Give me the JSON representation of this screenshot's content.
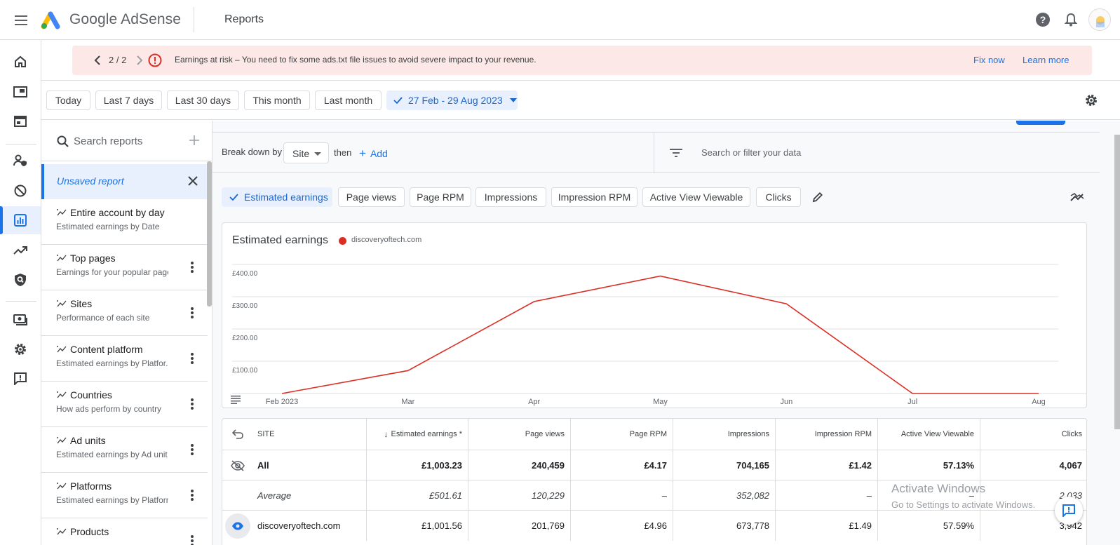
{
  "app": {
    "brand": "Google AdSense",
    "page_title": "Reports"
  },
  "alert": {
    "pager": "2 / 2",
    "message": "Earnings at risk – You need to fix some ads.txt file issues to avoid severe impact to your revenue.",
    "fix_now": "Fix now",
    "learn_more": "Learn more"
  },
  "date_ranges": [
    "Today",
    "Last 7 days",
    "Last 30 days",
    "This month",
    "Last month"
  ],
  "date_selected": "27 Feb - 29 Aug 2023",
  "sidebar": {
    "search_placeholder": "Search reports",
    "unsaved": "Unsaved report",
    "reports": [
      {
        "title": "Entire account by day",
        "subtitle": "Estimated earnings by Date"
      },
      {
        "title": "Top pages",
        "subtitle": "Earnings for your popular pages"
      },
      {
        "title": "Sites",
        "subtitle": "Performance of each site"
      },
      {
        "title": "Content platform",
        "subtitle": "Estimated earnings by Platfor..."
      },
      {
        "title": "Countries",
        "subtitle": "How ads perform by country"
      },
      {
        "title": "Ad units",
        "subtitle": "Estimated earnings by Ad unit"
      },
      {
        "title": "Platforms",
        "subtitle": "Estimated earnings by Platform"
      },
      {
        "title": "Products",
        "subtitle": ""
      }
    ]
  },
  "breakdown": {
    "label": "Break down by",
    "dimension": "Site",
    "then": "then",
    "add": "Add",
    "filter_placeholder": "Search or filter your data"
  },
  "metrics": [
    "Estimated earnings",
    "Page views",
    "Page RPM",
    "Impressions",
    "Impression RPM",
    "Active View Viewable",
    "Clicks"
  ],
  "chart_data": {
    "type": "line",
    "title": "Estimated earnings",
    "series": [
      {
        "name": "discoveryoftech.com",
        "color": "#d93025",
        "values": [
          0,
          71,
          285,
          364,
          278,
          0,
          0
        ]
      }
    ],
    "categories": [
      "Feb 2023",
      "Mar",
      "Apr",
      "May",
      "Jun",
      "Jul",
      "Aug"
    ],
    "ylim": [
      0,
      400
    ],
    "yticks": [
      "£100.00",
      "£200.00",
      "£300.00",
      "£400.00"
    ],
    "ytick_values": [
      100,
      200,
      300,
      400
    ],
    "grid": true
  },
  "table": {
    "columns": [
      "SITE",
      "Estimated earnings *",
      "Page views",
      "Page RPM",
      "Impressions",
      "Impression RPM",
      "Active View Viewable",
      "Clicks"
    ],
    "rows": [
      {
        "type": "total",
        "cells": [
          "All",
          "£1,003.23",
          "240,459",
          "£4.17",
          "704,165",
          "£1.42",
          "57.13%",
          "4,067"
        ]
      },
      {
        "type": "average",
        "cells": [
          "Average",
          "£501.61",
          "120,229",
          "–",
          "352,082",
          "–",
          "–",
          "2,033"
        ]
      },
      {
        "type": "row",
        "cells": [
          "discoveryoftech.com",
          "£1,001.56",
          "201,769",
          "£4.96",
          "673,778",
          "£1.49",
          "57.59%",
          "3,942"
        ]
      }
    ]
  },
  "watermark": {
    "line1": "Activate Windows",
    "line2": "Go to Settings to activate Windows."
  }
}
